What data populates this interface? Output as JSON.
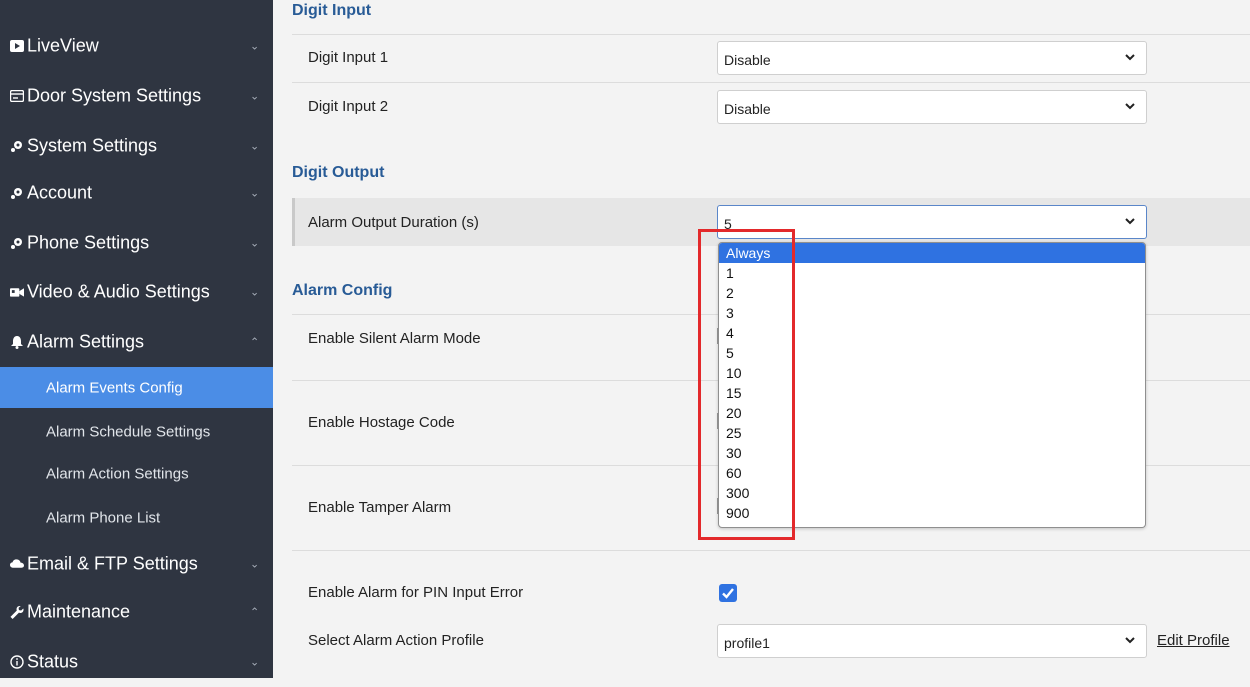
{
  "sidebar": {
    "items": [
      {
        "icon": "video-icon",
        "label": "LiveView",
        "chevron": "⌄"
      },
      {
        "icon": "door-icon",
        "label": "Door System Settings",
        "chevron": "⌄"
      },
      {
        "icon": "gear-icon",
        "label": "System Settings",
        "chevron": "⌄"
      },
      {
        "icon": "gear-icon",
        "label": "Account",
        "chevron": "⌄"
      },
      {
        "icon": "gear-icon",
        "label": "Phone Settings",
        "chevron": "⌄"
      },
      {
        "icon": "camera-icon",
        "label": "Video & Audio Settings",
        "chevron": "⌄"
      },
      {
        "icon": "bell-icon",
        "label": "Alarm Settings",
        "chevron": "⌃"
      },
      {
        "icon": "cloud-icon",
        "label": "Email & FTP Settings",
        "chevron": "⌄"
      },
      {
        "icon": "wrench-icon",
        "label": "Maintenance",
        "chevron": "⌃"
      },
      {
        "icon": "info-icon",
        "label": "Status",
        "chevron": "⌄"
      }
    ],
    "subitems": [
      {
        "label": "Alarm Events Config",
        "active": true
      },
      {
        "label": "Alarm Schedule Settings",
        "active": false
      },
      {
        "label": "Alarm Action Settings",
        "active": false
      },
      {
        "label": "Alarm Phone List",
        "active": false
      }
    ]
  },
  "main": {
    "digit_input": {
      "title": "Digit Input",
      "rows": [
        {
          "label": "Digit Input 1",
          "value": "Disable"
        },
        {
          "label": "Digit Input 2",
          "value": "Disable"
        }
      ]
    },
    "digit_output": {
      "title": "Digit Output",
      "rows": [
        {
          "label": "Alarm Output Duration (s)",
          "value": "5"
        }
      ]
    },
    "alarm_config": {
      "title": "Alarm Config",
      "rows": [
        {
          "label": "Enable Silent Alarm Mode"
        },
        {
          "label": "Enable Hostage Code"
        },
        {
          "label": "Enable Tamper Alarm"
        },
        {
          "label": "Enable Alarm for PIN Input Error",
          "checked": true
        },
        {
          "label": "Select Alarm Action Profile",
          "value": "profile1"
        }
      ],
      "edit_profile": "Edit Profile"
    }
  },
  "dropdown": {
    "options": [
      "Always",
      "1",
      "2",
      "3",
      "4",
      "5",
      "10",
      "15",
      "20",
      "25",
      "30",
      "60",
      "300",
      "900"
    ],
    "highlighted": "Always"
  },
  "colors": {
    "sidebar_bg": "#2f3541",
    "active_item": "#4b8de6",
    "section_title": "#285b96",
    "selection": "#2f72e1",
    "annotation_box": "#e3292b"
  }
}
